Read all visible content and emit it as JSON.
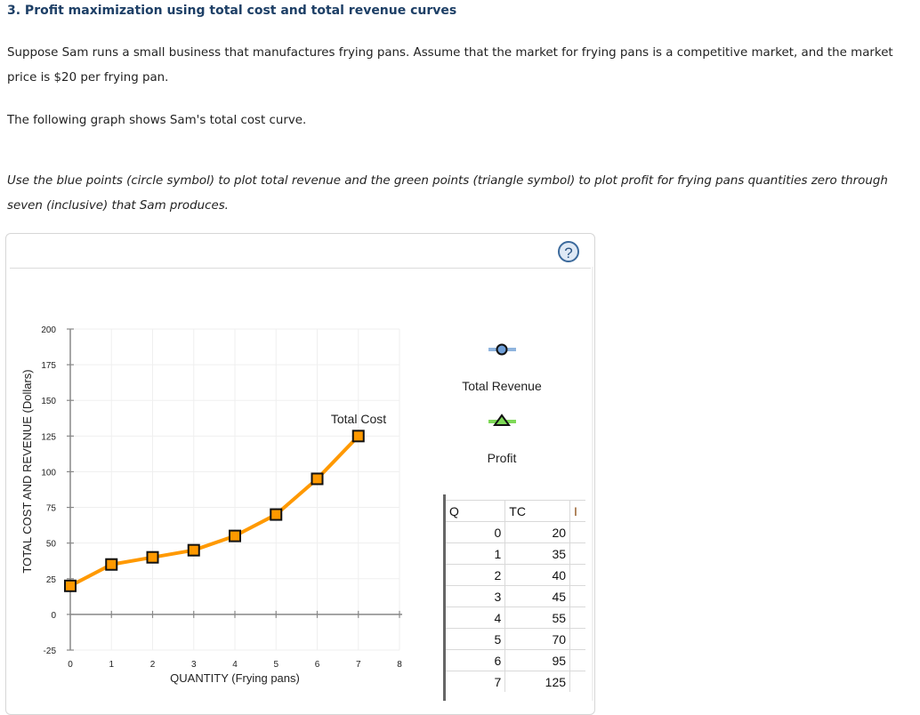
{
  "question": {
    "title": "3. Profit maximization using total cost and total revenue curves",
    "paragraph1": "Suppose Sam runs a small business that manufactures frying pans. Assume that the market for frying pans is a competitive market, and the market price is $20 per frying pan.",
    "paragraph2": "The following graph shows Sam's total cost curve.",
    "instructions": "Use the blue points (circle symbol) to plot total revenue and the green points (triangle symbol) to plot profit for frying pans quantities zero through seven (inclusive) that Sam produces."
  },
  "panel": {
    "help_label": "?",
    "help_icon": "question-mark-icon"
  },
  "legend": {
    "items": [
      {
        "label": "Total Revenue",
        "symbol": "circle",
        "line_color": "#8fb4de",
        "fill": "#6f9fd8"
      },
      {
        "label": "Profit",
        "symbol": "triangle",
        "line_color": "#7ed957",
        "fill": "#7ed957"
      }
    ]
  },
  "spreadsheet": {
    "headers": [
      "Q",
      "TC",
      "I"
    ],
    "rows": [
      [
        "0",
        "20"
      ],
      [
        "1",
        "35"
      ],
      [
        "2",
        "40"
      ],
      [
        "3",
        "45"
      ],
      [
        "4",
        "55"
      ],
      [
        "5",
        "70"
      ],
      [
        "6",
        "95"
      ],
      [
        "7",
        "125"
      ]
    ]
  },
  "chart_data": {
    "type": "line",
    "title": "",
    "xlabel": "QUANTITY (Frying pans)",
    "ylabel": "TOTAL COST AND REVENUE (Dollars)",
    "xlim": [
      0,
      8
    ],
    "ylim": [
      -25,
      200
    ],
    "x_ticks": [
      "0",
      "1",
      "2",
      "3",
      "4",
      "5",
      "6",
      "7",
      "8"
    ],
    "y_ticks": [
      "200",
      "175",
      "150",
      "125",
      "100",
      "75",
      "50",
      "25",
      "0",
      "-25"
    ],
    "grid": true,
    "series": [
      {
        "name": "Total Cost",
        "color": "#ff9900",
        "marker": "square",
        "x": [
          0,
          1,
          2,
          3,
          4,
          5,
          6,
          7
        ],
        "values": [
          20,
          35,
          40,
          45,
          55,
          70,
          95,
          125
        ],
        "label": "Total Cost"
      }
    ]
  }
}
